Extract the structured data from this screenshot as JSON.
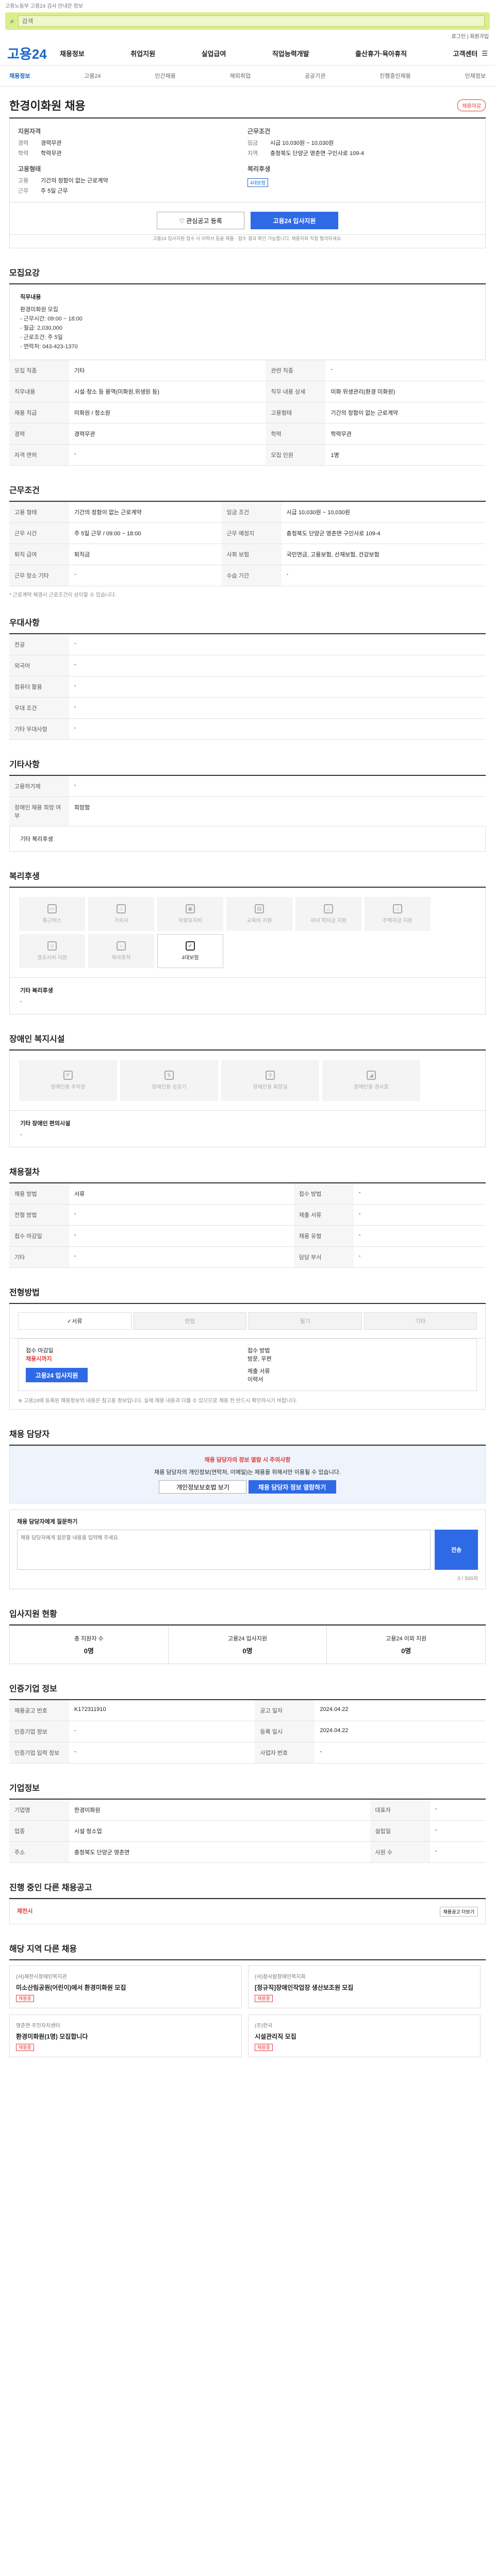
{
  "top_note": "고용노동부 고용24 검사 안내문 정보",
  "search": {
    "placeholder": "검색",
    "button": "로그인"
  },
  "login": "로그인 | 회원가입",
  "logo": "고용24",
  "nav": [
    "채용정보",
    "취업지원",
    "실업급여",
    "직업능력개발",
    "출산휴가·육아휴직",
    "고객센터"
  ],
  "snb": [
    "채용정보",
    "고용24",
    "민간채용",
    "해외취업",
    "공공기관",
    "진행중인채용",
    "인재정보"
  ],
  "job": {
    "title": "한경이화원 채용",
    "badge": "채용마감",
    "summary": {
      "h1": "지원자격",
      "k1": "경력",
      "v1": "경력무관",
      "k2": "학력",
      "v2": "학력무관",
      "h2": "근무조건",
      "k3": "임금",
      "v3": "시급 10,030원 ~ 10,030원",
      "k4": "지역",
      "v4": "충청북도 단양군 영춘면 구인사로 109-4",
      "h3": "고용형태",
      "k5": "고용",
      "v5": "기간의 정함이 없는 근로계약",
      "k6": "근무",
      "v6": "주 5일 근무",
      "h4": "복리후생",
      "chip": "4대보험"
    }
  },
  "actions": {
    "scrap": "관심공고 등록",
    "apply": "고용24 입사지원",
    "note": "고용24 입사지원 접수 시 이력서 등을 제출 · 접수 결과 확인 가능합니다. 채용자와 직접 협의하세요."
  },
  "s1": {
    "title": "모집요강",
    "t": "직무내용",
    "lines": [
      "환경미화원 모집",
      "- 근무시간: 09:00 ~ 18:00",
      "- 월급: 2,030,000",
      "- 근로조건: 주 5일",
      "- 연락처: 043-423-1370"
    ]
  },
  "s1tbl": [
    [
      "모집 직종",
      "기타",
      "관련 직종",
      "-"
    ],
    [
      "직무내용",
      "시설·청소 등 용역(미화원,위생원 등)",
      "직무 내용 상세",
      "미화 위생관리(환경 미화원)"
    ],
    [
      "채용 직급",
      "미화원 / 청소원",
      "고용형태",
      "기간의 정함이 없는 근로계약"
    ],
    [
      "경력",
      "경력무관",
      "학력",
      "학력무관"
    ],
    [
      "자격 면허",
      "-",
      "모집 인원",
      "1명"
    ]
  ],
  "s2": {
    "title": "근무조건"
  },
  "s2tbl": [
    [
      "고용 형태",
      "기간의 정함이 없는 근로계약",
      "임금 조건",
      "시급 10,030원 ~ 10,030원"
    ],
    [
      "근무 시간",
      "주 5일 근무 / 09:00 ~ 18:00",
      "근무 예정지",
      "충청북도 단양군 영춘면 구인사로 109-4"
    ],
    [
      "퇴직 급여",
      "퇴직금",
      "사회 보험",
      "국민연금, 고용보험, 산재보험, 건강보험"
    ],
    [
      "근무 장소 기타",
      "-",
      "수습 기간",
      "-"
    ]
  ],
  "s2note": "* 근로계약 체결시 근로조건이 상이할 수 있습니다.",
  "s3": {
    "title": "우대사항",
    "rows": [
      [
        "전공",
        "-"
      ],
      [
        "외국어",
        "-"
      ],
      [
        "컴퓨터 활용",
        "-"
      ],
      [
        "우대 조건",
        "-"
      ],
      [
        "기타 우대사항",
        "-"
      ]
    ]
  },
  "s4": {
    "title": "기타사항",
    "rows": [
      [
        "고용허가제",
        "-"
      ],
      [
        "장애인 채용 희망 여부",
        "희망함"
      ]
    ],
    "extra": "기타 복리후생"
  },
  "s5": {
    "title": "복리후생",
    "items": [
      {
        "label": "통근버스",
        "on": false
      },
      {
        "label": "기숙사",
        "on": false
      },
      {
        "label": "차량유지비",
        "on": false
      },
      {
        "label": "교육비 지원",
        "on": false
      },
      {
        "label": "자녀 학자금 지원",
        "on": false
      },
      {
        "label": "주택자금 지원",
        "on": false
      },
      {
        "label": "경조사비 지원",
        "on": false
      },
      {
        "label": "육아휴직",
        "on": false
      },
      {
        "label": "4대보험",
        "on": true
      }
    ],
    "note": "기타 복리후생",
    "note_v": "-"
  },
  "s6": {
    "title": "장애인 복지시설",
    "items": [
      "장애인용 주차장",
      "장애인용 승강기",
      "장애인용 화장실",
      "장애인용 경사로"
    ],
    "note": "기타 장애인 편의시설",
    "note_v": "-"
  },
  "s7": {
    "title": "채용절차",
    "rows": [
      [
        "채용 방법",
        "서류",
        "접수 방법",
        "-"
      ],
      [
        "전형 방법",
        "-",
        "제출 서류",
        "-"
      ],
      [
        "접수 마감일",
        "-",
        "채용 유형",
        "-"
      ],
      [
        "기타",
        "-",
        "담당 부서",
        "-"
      ]
    ]
  },
  "s8": {
    "title": "전형방법",
    "tabs": [
      "서류",
      "면접",
      "필기",
      "기타"
    ],
    "reg1": "접수 마감일",
    "reg2": "채용시까지",
    "reg3": "접수 방법",
    "reg4": "방문, 우편",
    "apply": "고용24 입사지원",
    "r5": "제출 서류",
    "r6": "이력서",
    "notes": "※ 고용24에 등록된 채용정보의 내용은 참고용 정보입니다. 실제 채용 내용과 다를 수 있으므로 채용 전 반드시 확인하시기 바랍니다."
  },
  "s9": {
    "title": "채용 담당자",
    "banner_t": "채용 담당자의 정보 열람 시 주의사항",
    "banner_d": "채용 담당자의 개인정보(연락처, 이메일)는 채용을 위해서만 이용될 수 있습니다.",
    "b1": "개인정보보호법 보기",
    "b2": "채용 담당자 정보 열람하기"
  },
  "s10": {
    "title": "채용 담당자에게 질문하기",
    "placeholder": "채용 담당자에게 질문할 내용을 입력해 주세요.",
    "btn": "전송",
    "count": "0 / 500자"
  },
  "s11": {
    "title": "입사지원 현황",
    "stats": [
      [
        "총 지원자 수",
        "0명"
      ],
      [
        "고용24 입사지원",
        "0명"
      ],
      [
        "고용24 이외 지원",
        "0명"
      ]
    ]
  },
  "s12": {
    "title": "인증기업 정보",
    "rows": [
      [
        "채용공고 번호",
        "K172311910",
        "공고 일자",
        "2024.04.22"
      ],
      [
        "인증기업 정보",
        "-",
        "등록 일시",
        "2024.04.22"
      ],
      [
        "인증기업 입력 정보",
        "-",
        "사업자 번호",
        "-"
      ]
    ]
  },
  "s13": {
    "title": "기업정보",
    "rows": [
      [
        "기업명",
        "한경이화원",
        "대표자",
        "-"
      ],
      [
        "업종",
        "시설 청소업",
        "설립일",
        "-"
      ],
      [
        "주소",
        "충청북도 단양군 영춘면",
        "사원 수",
        "-"
      ]
    ]
  },
  "s14": {
    "title": "진행 중인 다른 채용공고",
    "left": "제천시",
    "right": "채용공고 더보기"
  },
  "s15": {
    "title": "해당 지역 다른 채용",
    "items": [
      {
        "c": "(사)제천시장애인복지관",
        "t": "미소산림공원(어린이)에서 환경미화원 모집",
        "b": "채용중"
      },
      {
        "c": "(사)참사람장애인복지회",
        "t": "[정규직]장애인작업장 생산보조원 모집",
        "b": "채용중"
      },
      {
        "c": "영춘면 주민자치센터",
        "t": "환경미화원(1명) 모집합니다",
        "b": "채용중"
      },
      {
        "c": "(주)한국",
        "t": "시설관리직 모집",
        "b": "채용중"
      }
    ]
  }
}
